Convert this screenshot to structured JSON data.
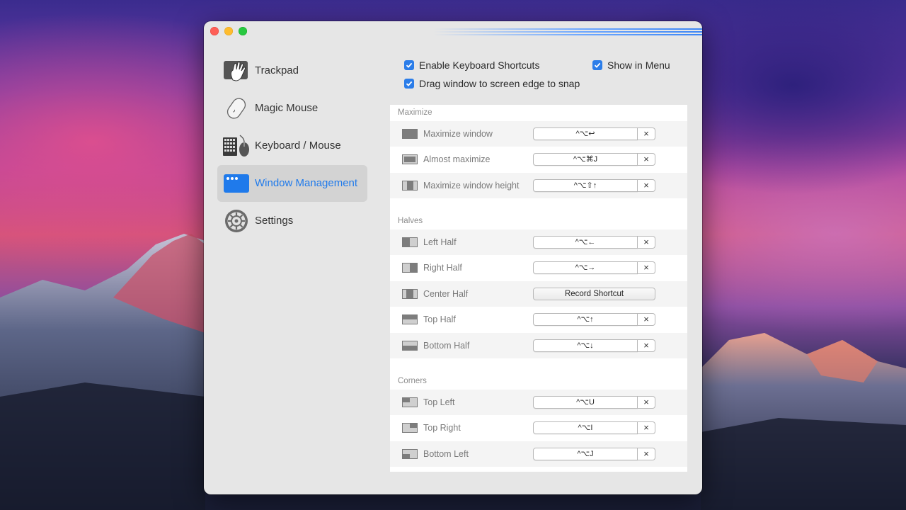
{
  "sidebar": {
    "items": [
      {
        "label": "Trackpad",
        "icon": "trackpad-hand-icon",
        "active": false
      },
      {
        "label": "Magic Mouse",
        "icon": "magic-mouse-icon",
        "active": false
      },
      {
        "label": "Keyboard / Mouse",
        "icon": "keyboard-mouse-icon",
        "active": false
      },
      {
        "label": "Window Management",
        "icon": "window-management-icon",
        "active": true
      },
      {
        "label": "Settings",
        "icon": "gear-icon",
        "active": false
      }
    ]
  },
  "options": {
    "enable_shortcuts": {
      "label": "Enable Keyboard Shortcuts",
      "checked": true
    },
    "show_in_menu": {
      "label": "Show in Menu",
      "checked": true
    },
    "drag_snap": {
      "label": "Drag window to screen edge to snap",
      "checked": true
    }
  },
  "sections": {
    "maximize": {
      "title": "Maximize",
      "rows": [
        {
          "label": "Maximize window",
          "shortcut": "^⌥↩",
          "icon": "maximize-icon"
        },
        {
          "label": "Almost maximize",
          "shortcut": "^⌥⌘J",
          "icon": "almost-maximize-icon"
        },
        {
          "label": "Maximize window height",
          "shortcut": "^⌥⇧↑",
          "icon": "maximize-height-icon"
        }
      ]
    },
    "halves": {
      "title": "Halves",
      "rows": [
        {
          "label": "Left Half",
          "shortcut": "^⌥←",
          "icon": "left-half-icon"
        },
        {
          "label": "Right Half",
          "shortcut": "^⌥→",
          "icon": "right-half-icon"
        },
        {
          "label": "Center Half",
          "shortcut": "Record Shortcut",
          "icon": "center-half-icon"
        },
        {
          "label": "Top Half",
          "shortcut": "^⌥↑",
          "icon": "top-half-icon"
        },
        {
          "label": "Bottom Half",
          "shortcut": "^⌥↓",
          "icon": "bottom-half-icon"
        }
      ]
    },
    "corners": {
      "title": "Corners",
      "rows": [
        {
          "label": "Top Left",
          "shortcut": "^⌥U",
          "icon": "top-left-icon"
        },
        {
          "label": "Top Right",
          "shortcut": "^⌥I",
          "icon": "top-right-icon"
        },
        {
          "label": "Bottom Left",
          "shortcut": "^⌥J",
          "icon": "bottom-left-icon"
        }
      ]
    }
  },
  "clear_glyph": "×",
  "colors": {
    "accent": "#1f7aeb",
    "checkbox": "#2b7de9"
  }
}
